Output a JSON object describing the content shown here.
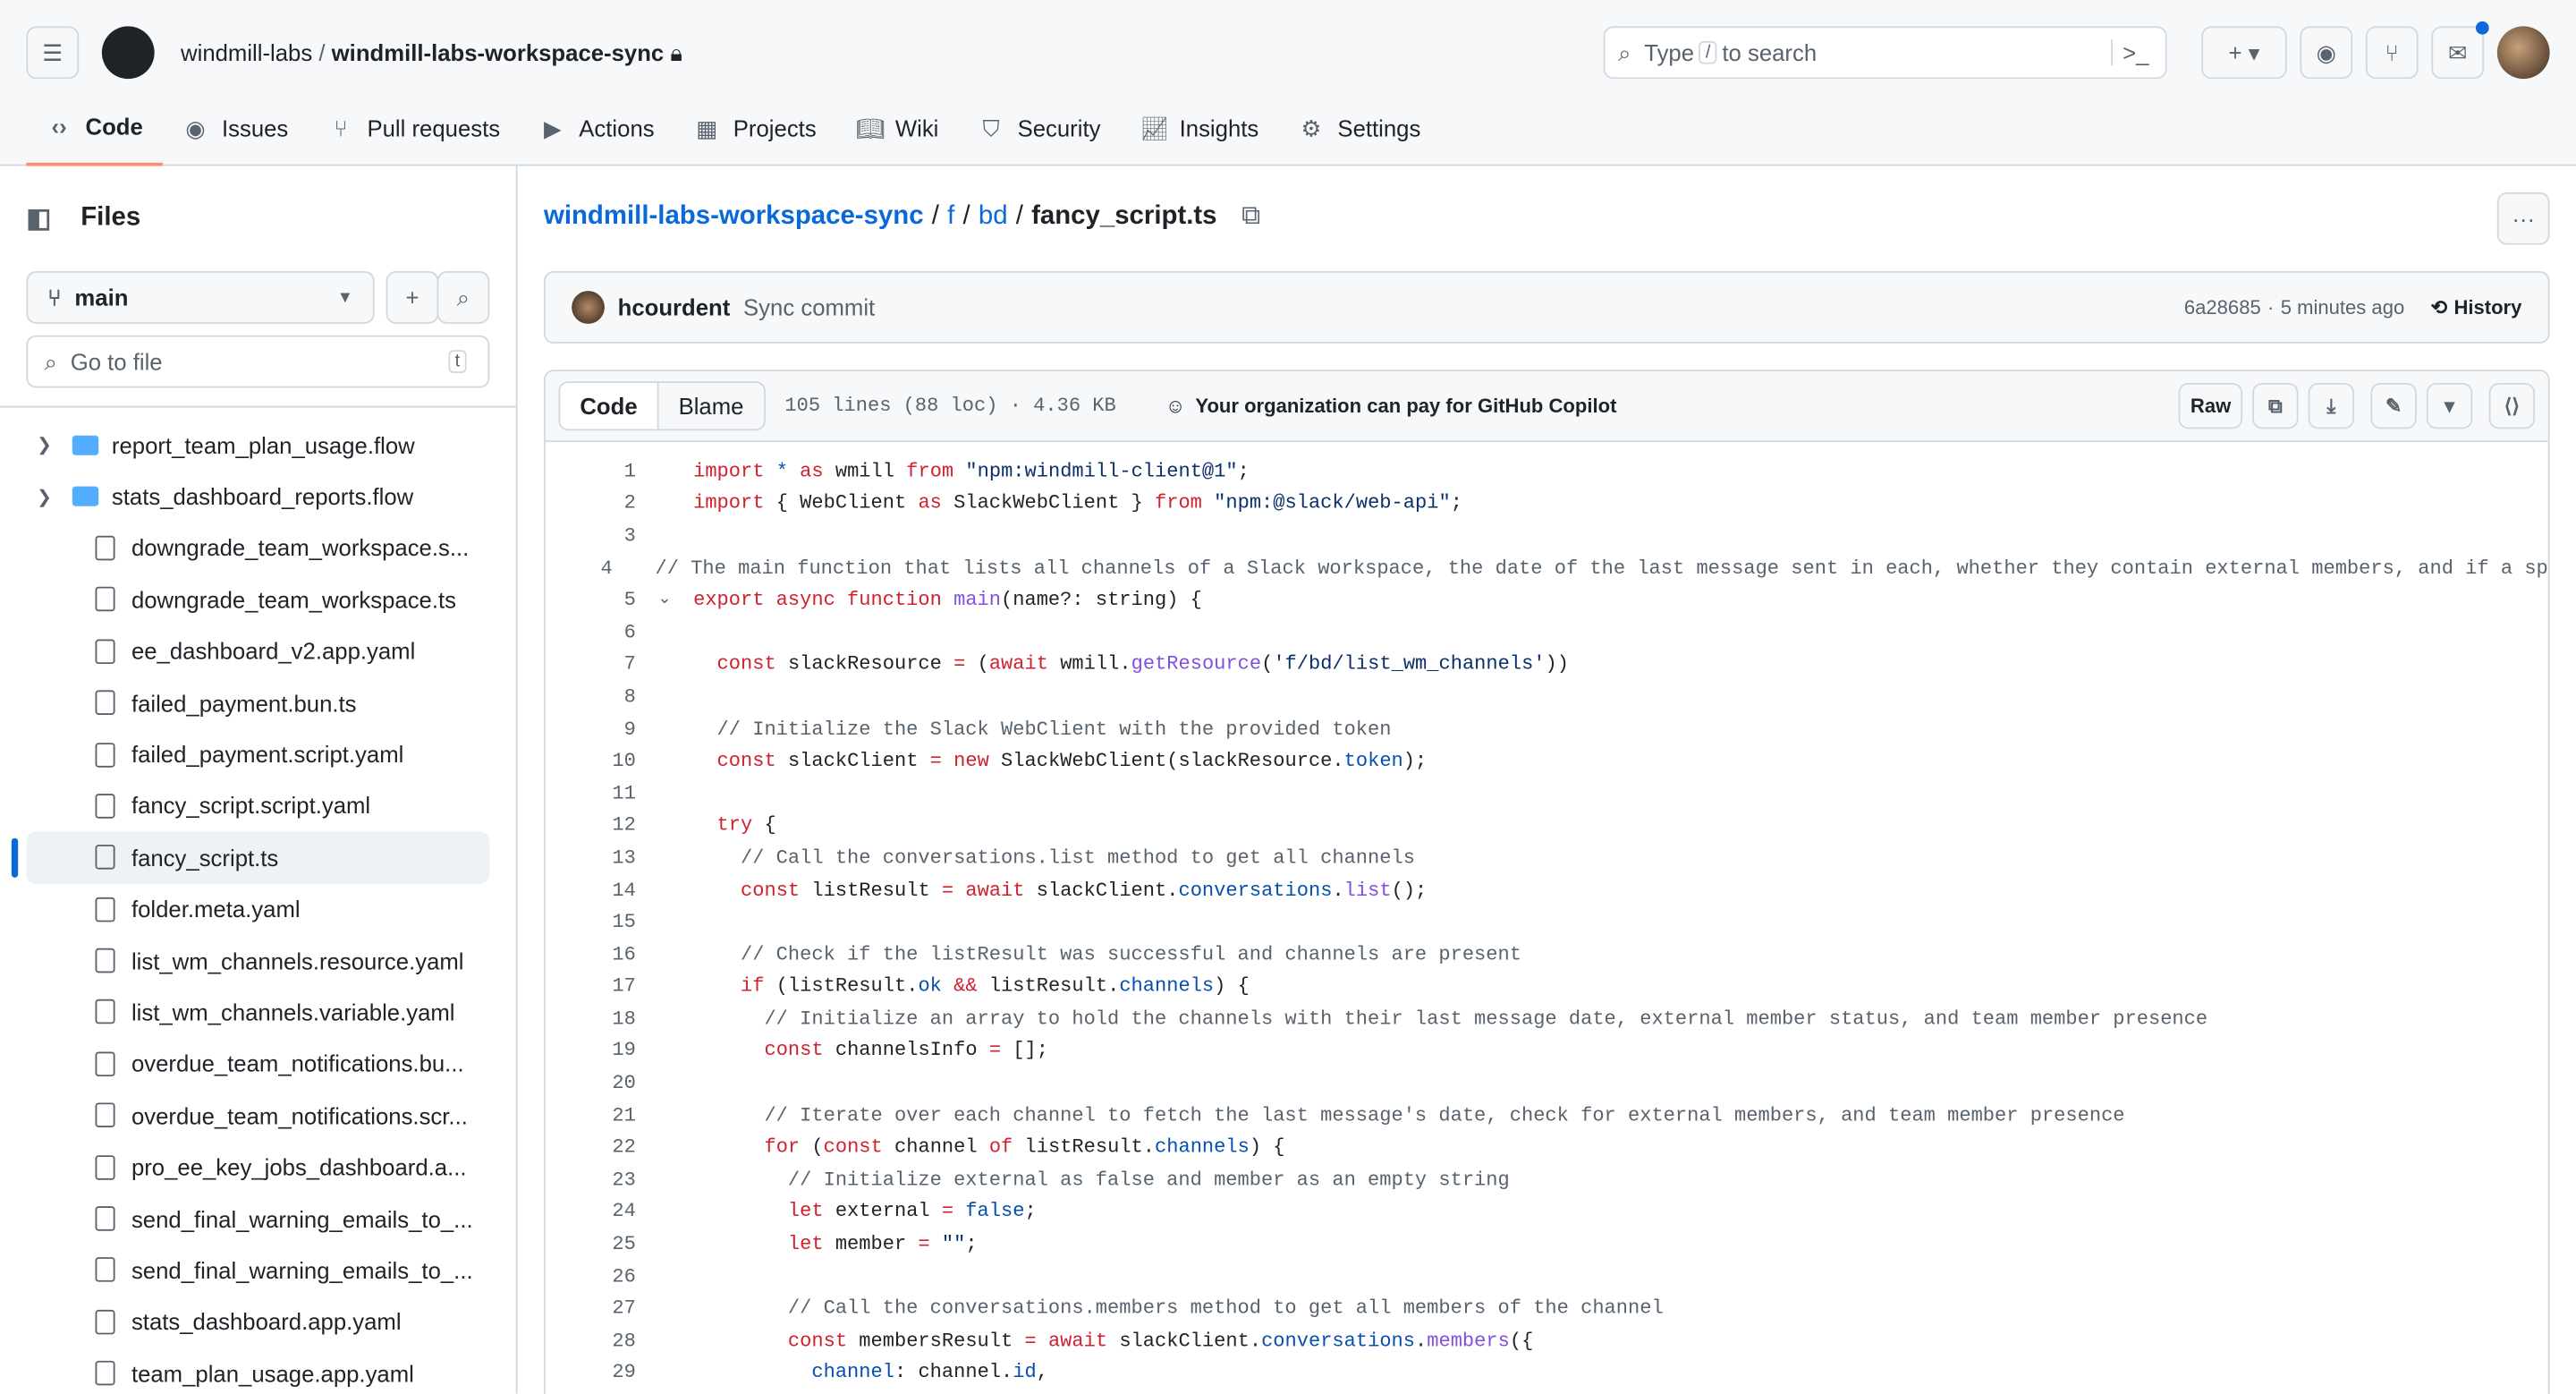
{
  "header": {
    "owner": "windmill-labs",
    "repo": "windmill-labs-workspace-sync",
    "search_placeholder_pre": "Type",
    "search_key": "/",
    "search_placeholder_post": "to search"
  },
  "tabs": [
    {
      "label": "Code",
      "icon": "code-icon",
      "sel": true
    },
    {
      "label": "Issues",
      "icon": "issue-icon"
    },
    {
      "label": "Pull requests",
      "icon": "pull-request-icon"
    },
    {
      "label": "Actions",
      "icon": "play-icon"
    },
    {
      "label": "Projects",
      "icon": "table-icon"
    },
    {
      "label": "Wiki",
      "icon": "book-icon"
    },
    {
      "label": "Security",
      "icon": "shield-icon"
    },
    {
      "label": "Insights",
      "icon": "graph-icon"
    },
    {
      "label": "Settings",
      "icon": "gear-icon"
    }
  ],
  "sidebar": {
    "title": "Files",
    "branch": "main",
    "goto_placeholder": "Go to file",
    "goto_key": "t",
    "items": [
      {
        "name": "report_team_plan_usage.flow",
        "type": "folder"
      },
      {
        "name": "stats_dashboard_reports.flow",
        "type": "folder"
      },
      {
        "name": "downgrade_team_workspace.s...",
        "type": "file"
      },
      {
        "name": "downgrade_team_workspace.ts",
        "type": "file"
      },
      {
        "name": "ee_dashboard_v2.app.yaml",
        "type": "file"
      },
      {
        "name": "failed_payment.bun.ts",
        "type": "file"
      },
      {
        "name": "failed_payment.script.yaml",
        "type": "file"
      },
      {
        "name": "fancy_script.script.yaml",
        "type": "file"
      },
      {
        "name": "fancy_script.ts",
        "type": "file",
        "selected": true
      },
      {
        "name": "folder.meta.yaml",
        "type": "file"
      },
      {
        "name": "list_wm_channels.resource.yaml",
        "type": "file"
      },
      {
        "name": "list_wm_channels.variable.yaml",
        "type": "file"
      },
      {
        "name": "overdue_team_notifications.bu...",
        "type": "file"
      },
      {
        "name": "overdue_team_notifications.scr...",
        "type": "file"
      },
      {
        "name": "pro_ee_key_jobs_dashboard.a...",
        "type": "file"
      },
      {
        "name": "send_final_warning_emails_to_...",
        "type": "file"
      },
      {
        "name": "send_final_warning_emails_to_...",
        "type": "file"
      },
      {
        "name": "stats_dashboard.app.yaml",
        "type": "file"
      },
      {
        "name": "team_plan_usage.app.yaml",
        "type": "file"
      }
    ]
  },
  "breadcrumb": {
    "repo": "windmill-labs-workspace-sync",
    "parts": [
      "f",
      "bd"
    ],
    "file": "fancy_script.ts"
  },
  "commit": {
    "author": "hcourdent",
    "message": "Sync commit",
    "sha": "6a28685",
    "time": "5 minutes ago",
    "history": "History"
  },
  "file": {
    "tab_code": "Code",
    "tab_blame": "Blame",
    "meta": "105 lines (88 loc) · 4.36 KB",
    "copilot": "Your organization can pay for GitHub Copilot",
    "raw": "Raw"
  },
  "code": [
    [
      [
        "k",
        "import"
      ],
      [
        "p",
        " *"
      ],
      [
        "k",
        " as"
      ],
      [
        "",
        " wmill "
      ],
      [
        "k",
        "from"
      ],
      [
        "s",
        " \"npm:windmill-client@1\""
      ],
      [
        "",
        ";"
      ]
    ],
    [
      [
        "k",
        "import"
      ],
      [
        "",
        " { WebClient "
      ],
      [
        "k",
        "as"
      ],
      [
        "",
        " SlackWebClient } "
      ],
      [
        "k",
        "from"
      ],
      [
        "s",
        " \"npm:@slack/web-api\""
      ],
      [
        "",
        ";"
      ]
    ],
    [],
    [
      [
        "c",
        "// The main function that lists all channels of a Slack workspace, the date of the last message sent in each, whether they contain external members, and if a sp"
      ]
    ],
    [
      [
        "k",
        "export async function "
      ],
      [
        "f",
        "main"
      ],
      [
        "",
        "(name?: string) {"
      ]
    ],
    [],
    [
      [
        "",
        "  "
      ],
      [
        "k",
        "const"
      ],
      [
        "",
        " slackResource "
      ],
      [
        "k",
        "="
      ],
      [
        "",
        " ("
      ],
      [
        "k",
        "await"
      ],
      [
        "",
        " wmill."
      ],
      [
        "f",
        "getResource"
      ],
      [
        "",
        "("
      ],
      [
        "s",
        "'f/bd/list_wm_channels'"
      ],
      [
        "",
        "))"
      ]
    ],
    [],
    [
      [
        "c",
        "  // Initialize the Slack WebClient with the provided token"
      ]
    ],
    [
      [
        "",
        "  "
      ],
      [
        "k",
        "const"
      ],
      [
        "",
        " slackClient "
      ],
      [
        "k",
        "="
      ],
      [
        "k",
        " new"
      ],
      [
        "",
        " SlackWebClient(slackResource."
      ],
      [
        "p",
        "token"
      ],
      [
        "",
        ");"
      ]
    ],
    [],
    [
      [
        "",
        "  "
      ],
      [
        "k",
        "try"
      ],
      [
        "",
        " {"
      ]
    ],
    [
      [
        "c",
        "    // Call the conversations.list method to get all channels"
      ]
    ],
    [
      [
        "",
        "    "
      ],
      [
        "k",
        "const"
      ],
      [
        "",
        " listResult "
      ],
      [
        "k",
        "="
      ],
      [
        "k",
        " await"
      ],
      [
        "",
        " slackClient."
      ],
      [
        "p",
        "conversations"
      ],
      [
        "",
        "."
      ],
      [
        "f",
        "list"
      ],
      [
        "",
        "();"
      ]
    ],
    [],
    [
      [
        "c",
        "    // Check if the listResult was successful and channels are present"
      ]
    ],
    [
      [
        "",
        "    "
      ],
      [
        "k",
        "if"
      ],
      [
        "",
        " (listResult."
      ],
      [
        "p",
        "ok"
      ],
      [
        "k",
        " &&"
      ],
      [
        "",
        " listResult."
      ],
      [
        "p",
        "channels"
      ],
      [
        "",
        ") {"
      ]
    ],
    [
      [
        "c",
        "      // Initialize an array to hold the channels with their last message date, external member status, and team member presence"
      ]
    ],
    [
      [
        "",
        "      "
      ],
      [
        "k",
        "const"
      ],
      [
        "",
        " channelsInfo "
      ],
      [
        "k",
        "="
      ],
      [
        "",
        " [];"
      ]
    ],
    [],
    [
      [
        "c",
        "      // Iterate over each channel to fetch the last message's date, check for external members, and team member presence"
      ]
    ],
    [
      [
        "",
        "      "
      ],
      [
        "k",
        "for"
      ],
      [
        "",
        " ("
      ],
      [
        "k",
        "const"
      ],
      [
        "",
        " channel "
      ],
      [
        "k",
        "of"
      ],
      [
        "",
        " listResult."
      ],
      [
        "p",
        "channels"
      ],
      [
        "",
        ") {"
      ]
    ],
    [
      [
        "c",
        "        // Initialize external as false and member as an empty string"
      ]
    ],
    [
      [
        "",
        "        "
      ],
      [
        "k",
        "let"
      ],
      [
        "",
        " external "
      ],
      [
        "k",
        "="
      ],
      [
        "p",
        " false"
      ],
      [
        "",
        ";"
      ]
    ],
    [
      [
        "",
        "        "
      ],
      [
        "k",
        "let"
      ],
      [
        "",
        " member "
      ],
      [
        "k",
        "="
      ],
      [
        "s",
        " \"\""
      ],
      [
        "",
        ";"
      ]
    ],
    [],
    [
      [
        "c",
        "        // Call the conversations.members method to get all members of the channel"
      ]
    ],
    [
      [
        "",
        "        "
      ],
      [
        "k",
        "const"
      ],
      [
        "",
        " membersResult "
      ],
      [
        "k",
        "="
      ],
      [
        "k",
        " await"
      ],
      [
        "",
        " slackClient."
      ],
      [
        "p",
        "conversations"
      ],
      [
        "",
        "."
      ],
      [
        "f",
        "members"
      ],
      [
        "",
        "({"
      ]
    ],
    [
      [
        "",
        "          "
      ],
      [
        "p",
        "channel"
      ],
      [
        "",
        ": channel."
      ],
      [
        "p",
        "id"
      ],
      [
        "",
        ","
      ]
    ]
  ],
  "colors": {
    "accent": "#0969da",
    "tab_underline": "#fd8c73",
    "keyword": "#cf222e",
    "string": "#0a3069",
    "function": "#8250df",
    "comment": "#59636e"
  }
}
